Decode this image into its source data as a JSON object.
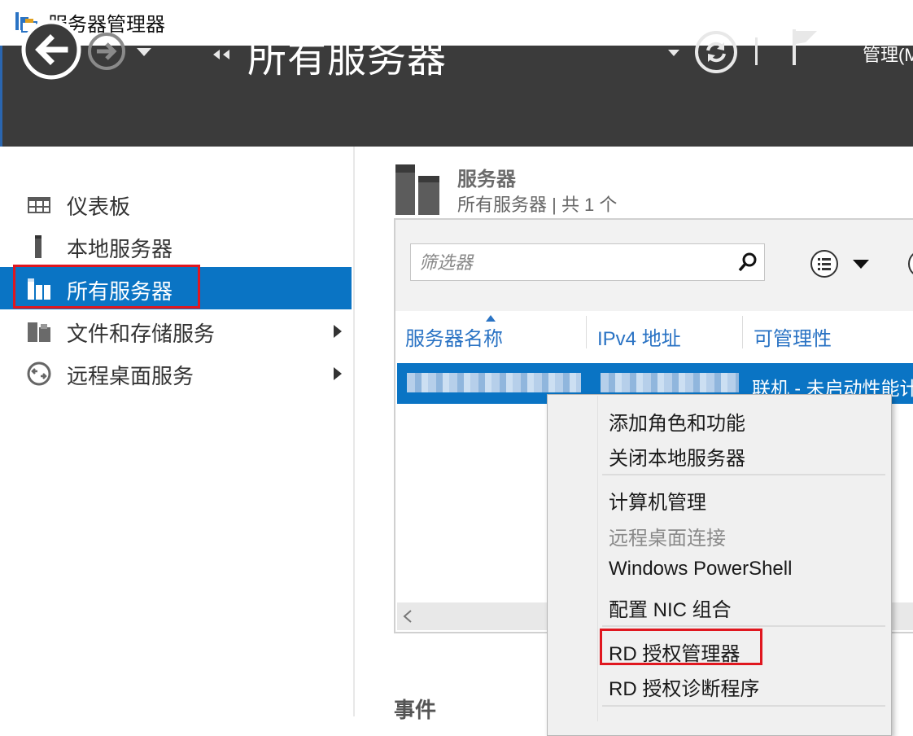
{
  "window": {
    "title": "服务器管理器"
  },
  "header": {
    "title": "所有服务器",
    "manage_label": "管理(M)"
  },
  "sidebar": {
    "items": [
      {
        "label": "仪表板",
        "icon": "dashboard-icon"
      },
      {
        "label": "本地服务器",
        "icon": "local-server-icon"
      },
      {
        "label": "所有服务器",
        "icon": "all-servers-icon",
        "selected": true
      },
      {
        "label": "文件和存储服务",
        "icon": "file-storage-icon",
        "has_submenu": true
      },
      {
        "label": "远程桌面服务",
        "icon": "remote-desktop-icon",
        "has_submenu": true
      }
    ]
  },
  "servers_section": {
    "title": "服务器",
    "subtitle": "所有服务器 | 共 1 个",
    "filter_placeholder": "筛选器",
    "columns": [
      "服务器名称",
      "IPv4 地址",
      "可管理性"
    ],
    "rows": [
      {
        "name": "iZ…",
        "ipv4": "",
        "manageability": "联机 - 未启动性能计数器"
      }
    ]
  },
  "context_menu": {
    "groups": [
      [
        "添加角色和功能",
        "关闭本地服务器"
      ],
      [
        "计算机管理",
        "远程桌面连接",
        "Windows PowerShell",
        "配置 NIC 组合"
      ],
      [
        "RD 授权管理器",
        "RD 授权诊断程序"
      ]
    ],
    "disabled": [
      "远程桌面连接"
    ],
    "highlighted": "RD 授权管理器"
  },
  "events_section": {
    "title": "事件"
  },
  "colors": {
    "header_bg": "#3b3b3b",
    "accent_blue": "#0a74c4",
    "link_blue": "#2a73c4",
    "highlight_red": "#e0171f"
  }
}
